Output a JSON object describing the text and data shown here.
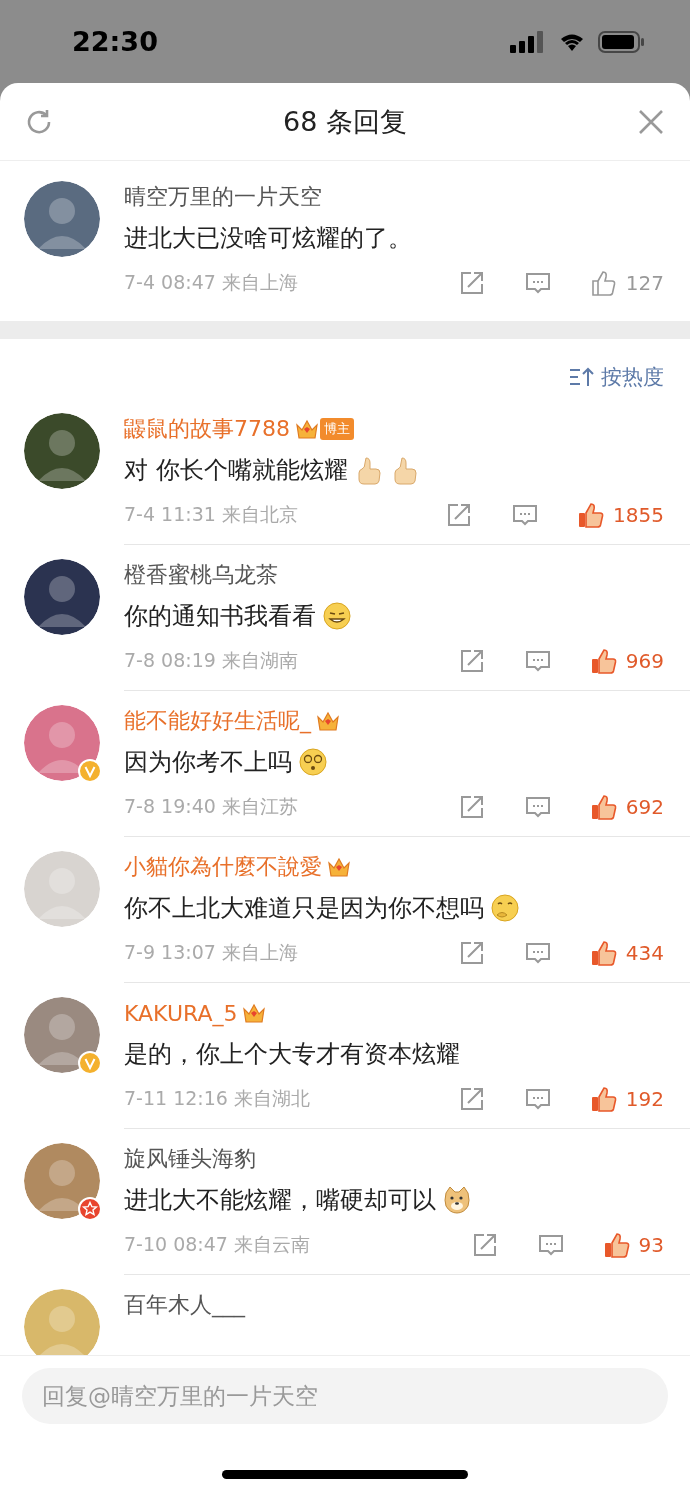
{
  "status_bar": {
    "time": "22:30"
  },
  "header": {
    "title": "68 条回复"
  },
  "main_comment": {
    "name": "晴空万里的一片天空",
    "text": "进北大已没啥可炫耀的了。",
    "time": "7-4 08:47",
    "location": "来自上海",
    "likes": "127",
    "liked": false
  },
  "sort": {
    "label": "按热度"
  },
  "replies": [
    {
      "name": "鼹鼠的故事7788",
      "vip": true,
      "crown": true,
      "tag": "博主",
      "text": "对 你长个嘴就能炫耀",
      "emojis": [
        {
          "kind": "thumbs-up"
        },
        {
          "kind": "thumbs-up"
        }
      ],
      "time": "7-4 11:31",
      "location": "来自北京",
      "likes": "1855",
      "liked": true
    },
    {
      "name": "橙香蜜桃乌龙茶",
      "vip": false,
      "crown": false,
      "text": "你的通知书我看看",
      "emojis": [
        {
          "kind": "smirk"
        }
      ],
      "time": "7-8 08:19",
      "location": "来自湖南",
      "likes": "969",
      "liked": true
    },
    {
      "name": "能不能好好生活呢_",
      "vip": true,
      "crown": true,
      "avatar_badge": {
        "kind": "gold-v"
      },
      "text": "因为你考不上吗",
      "emojis": [
        {
          "kind": "dizzy"
        }
      ],
      "time": "7-8 19:40",
      "location": "来自江苏",
      "likes": "692",
      "liked": true
    },
    {
      "name": "小貓你為什麼不說愛",
      "vip": true,
      "crown": true,
      "text": "你不上北大难道只是因为你不想吗",
      "emojis": [
        {
          "kind": "thinking"
        }
      ],
      "time": "7-9 13:07",
      "location": "来自上海",
      "likes": "434",
      "liked": true
    },
    {
      "name": "KAKURA_5",
      "vip": true,
      "crown": true,
      "avatar_badge": {
        "kind": "gold-v"
      },
      "text": "是的，你上个大专才有资本炫耀",
      "time": "7-11 12:16",
      "location": "来自湖北",
      "likes": "192",
      "liked": true
    },
    {
      "name": "旋风锤头海豹",
      "vip": false,
      "crown": false,
      "avatar_badge": {
        "kind": "red-star"
      },
      "text": "进北大不能炫耀，嘴硬却可以",
      "emojis": [
        {
          "kind": "doge"
        }
      ],
      "time": "7-10 08:47",
      "location": "来自云南",
      "likes": "93",
      "liked": true
    },
    {
      "name": "百年木人___",
      "vip": false,
      "crown": false
    }
  ],
  "reply_input": {
    "placeholder": "回复@晴空万里的一片天空"
  }
}
